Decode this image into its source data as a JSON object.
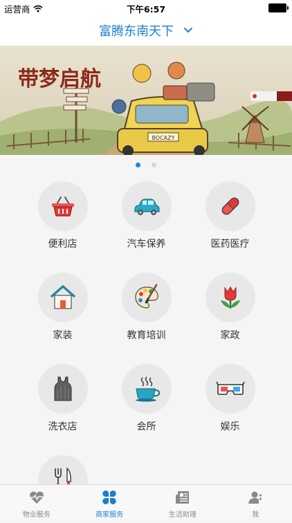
{
  "status_bar": {
    "carrier": "运营商",
    "time": "下午6:57"
  },
  "nav": {
    "title": "富腾东南天下"
  },
  "banner": {
    "headline": "带梦启航",
    "plate": "BOCAZY"
  },
  "carousel": {
    "count": 2,
    "active": 0
  },
  "services": [
    {
      "label": "便利店",
      "icon": "basket-icon"
    },
    {
      "label": "汽车保养",
      "icon": "car-icon"
    },
    {
      "label": "医药医疗",
      "icon": "pill-icon"
    },
    {
      "label": "家装",
      "icon": "house-icon"
    },
    {
      "label": "教育培训",
      "icon": "palette-icon"
    },
    {
      "label": "家政",
      "icon": "tulip-icon"
    },
    {
      "label": "洗衣店",
      "icon": "vest-icon"
    },
    {
      "label": "会所",
      "icon": "coffee-cup-icon"
    },
    {
      "label": "娱乐",
      "icon": "3d-glasses-icon"
    },
    {
      "label": "",
      "icon": "fork-knife-icon"
    }
  ],
  "tabs": [
    {
      "label": "物业服务",
      "icon": "heartbeat-icon",
      "active": false
    },
    {
      "label": "商家服务",
      "icon": "grid-clover-icon",
      "active": true
    },
    {
      "label": "生活助理",
      "icon": "newspaper-icon",
      "active": false
    },
    {
      "label": "我",
      "icon": "person-icon",
      "active": false
    }
  ],
  "colors": {
    "accent": "#1a7fd1",
    "circle_bg": "#e8e8e8",
    "page_bg": "#f5f5f5"
  }
}
